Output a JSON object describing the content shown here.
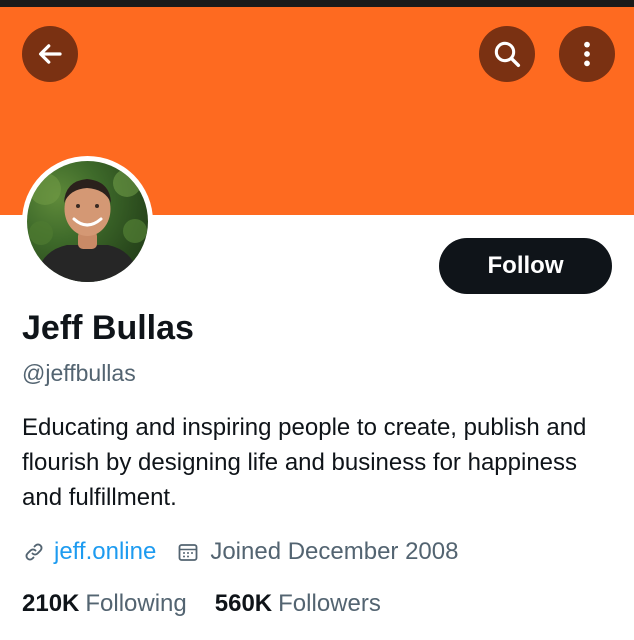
{
  "header": {
    "banner_color": "#fe6a20",
    "back_icon": "arrow-left-icon",
    "search_icon": "search-icon",
    "more_icon": "more-vertical-icon"
  },
  "profile": {
    "avatar": "profile-photo",
    "display_name": "Jeff Bullas",
    "handle": "@jeffbullas",
    "bio": "Educating and inspiring people to create, publish and flourish by designing life and business for happiness and fulfillment.",
    "follow_label": "Follow",
    "website": "jeff.online",
    "website_icon": "link-icon",
    "joined": "Joined December 2008",
    "joined_icon": "calendar-icon"
  },
  "stats": {
    "following_count": "210K",
    "following_label": "Following",
    "followers_count": "560K",
    "followers_label": "Followers"
  },
  "colors": {
    "accent_link": "#1d9bf0",
    "primary_text": "#0f1419",
    "secondary_text": "#536471"
  }
}
